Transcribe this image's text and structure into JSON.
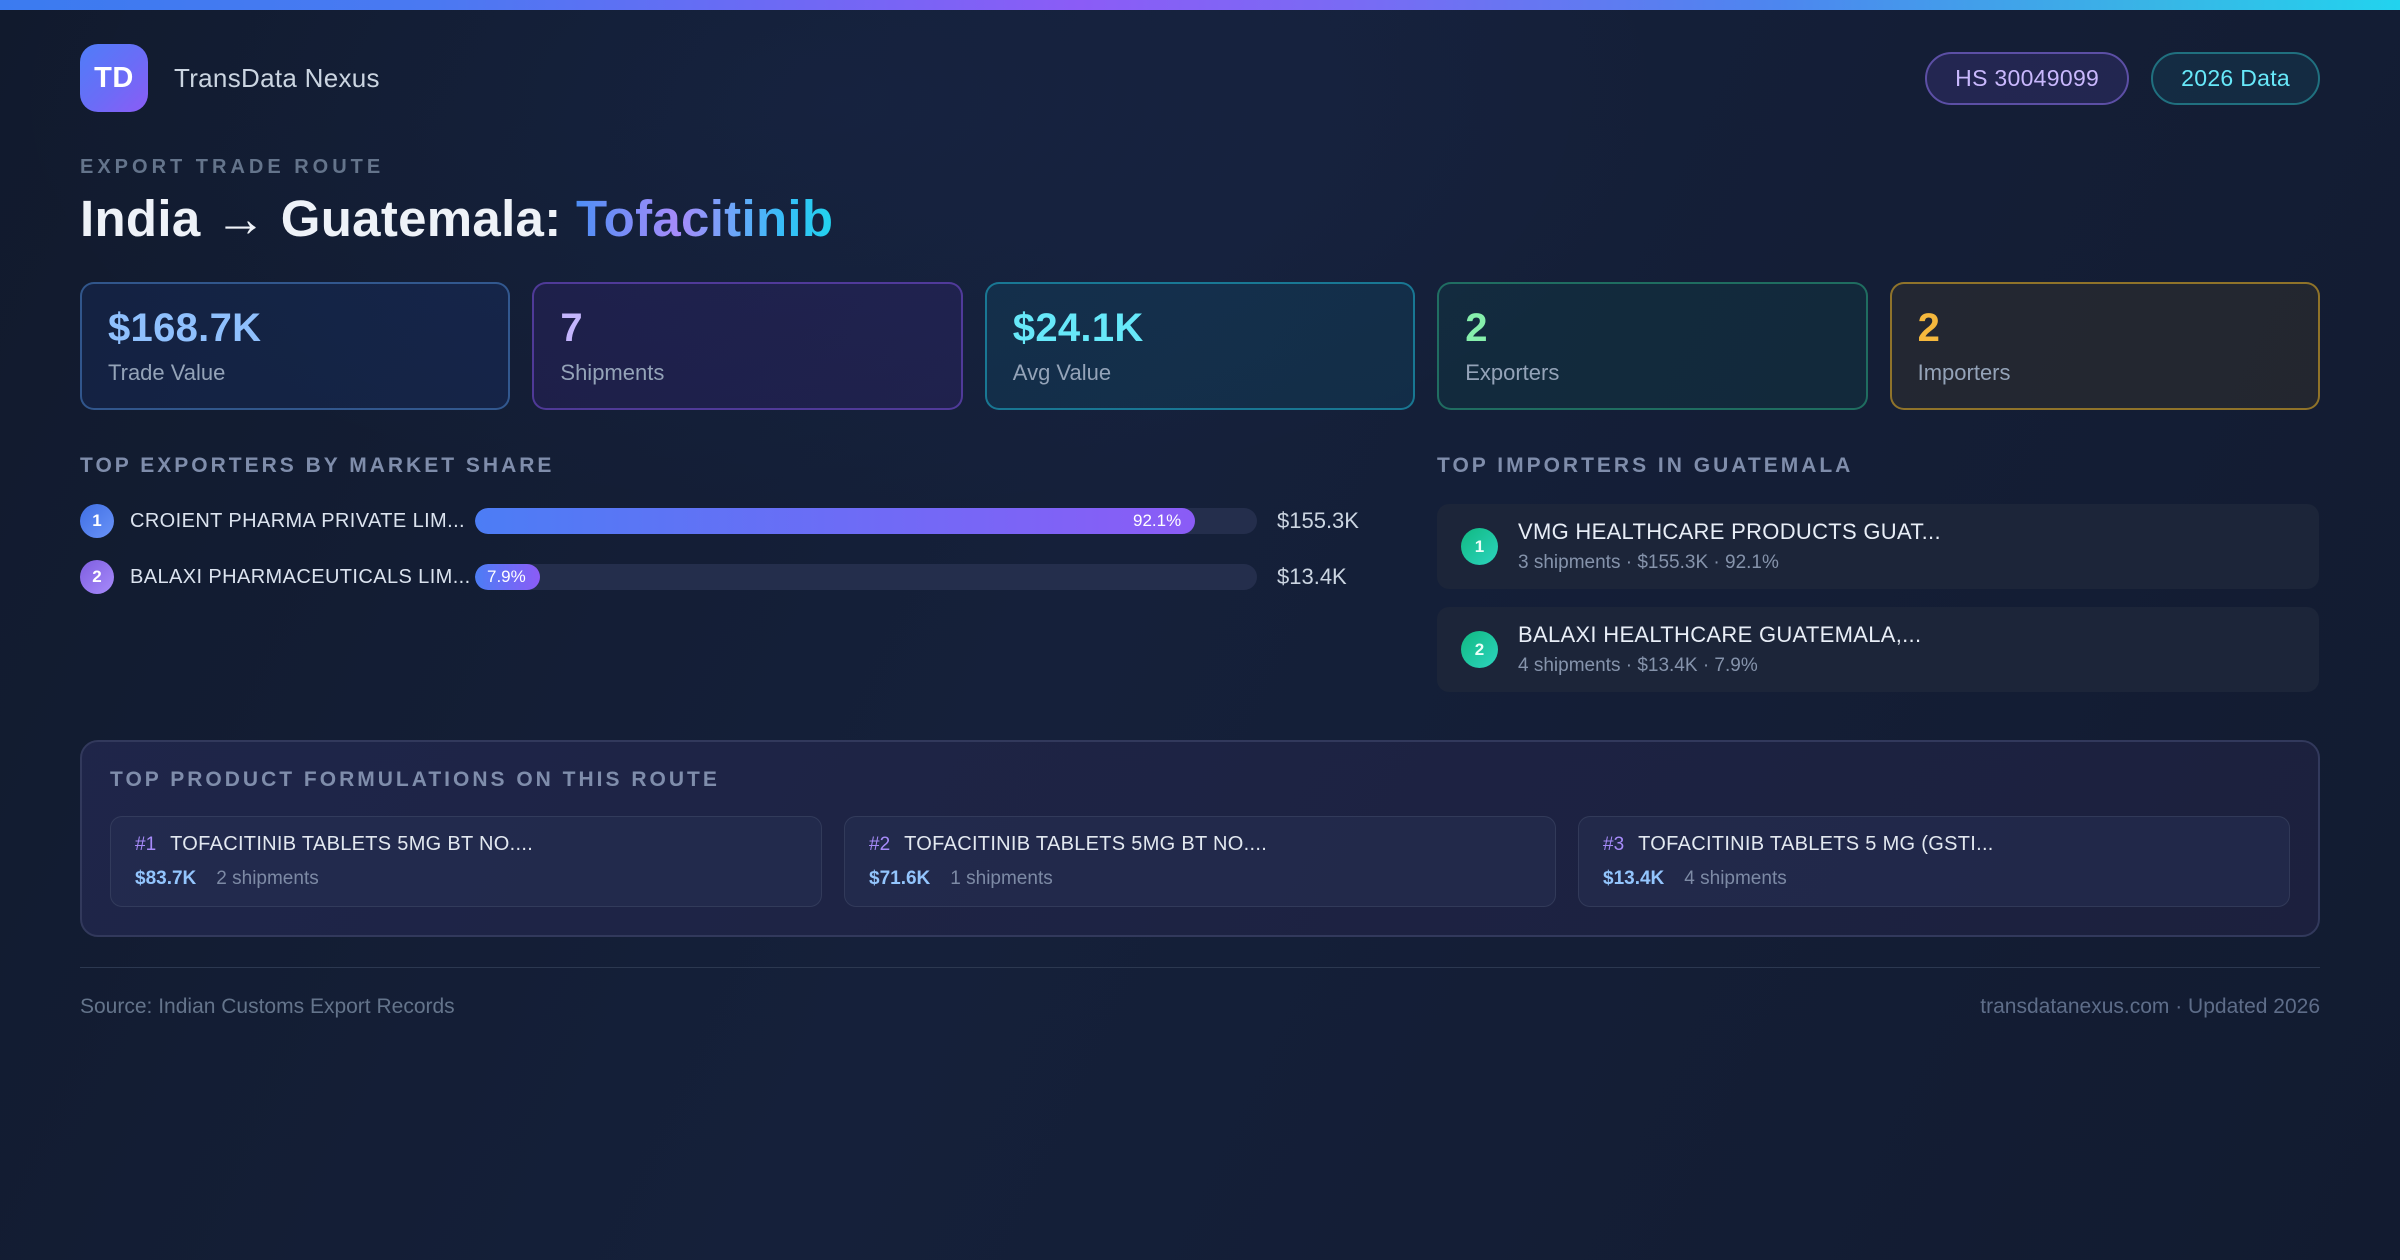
{
  "colors": {
    "accent_blue": "#3b82f6",
    "accent_purple": "#8b5cf6",
    "accent_cyan": "#22d3ee",
    "background": "#131c30"
  },
  "header": {
    "logo_text": "TD",
    "brand": "TransData Nexus",
    "hs_badge": "HS 30049099",
    "year_badge": "2026 Data"
  },
  "title": {
    "eyebrow": "EXPORT TRADE ROUTE",
    "route": "India → Guatemala: ",
    "product": "Tofacitinib"
  },
  "stats": [
    {
      "value": "$168.7K",
      "label": "Trade Value"
    },
    {
      "value": "7",
      "label": "Shipments"
    },
    {
      "value": "$24.1K",
      "label": "Avg Value"
    },
    {
      "value": "2",
      "label": "Exporters"
    },
    {
      "value": "2",
      "label": "Importers"
    }
  ],
  "exporters": {
    "section_title": "TOP EXPORTERS BY MARKET SHARE",
    "rows": [
      {
        "rank": "1",
        "name": "CROIENT PHARMA PRIVATE LIM...",
        "share_pct": 92.1,
        "share_label": "92.1%",
        "value": "$155.3K"
      },
      {
        "rank": "2",
        "name": "BALAXI PHARMACEUTICALS LIM...",
        "share_pct": 7.9,
        "share_label": "7.9%",
        "value": "$13.4K"
      }
    ]
  },
  "importers": {
    "section_title": "TOP IMPORTERS IN GUATEMALA",
    "rows": [
      {
        "rank": "1",
        "name": "VMG HEALTHCARE PRODUCTS GUAT...",
        "meta": "3 shipments · $155.3K · 92.1%"
      },
      {
        "rank": "2",
        "name": "BALAXI HEALTHCARE GUATEMALA,...",
        "meta": "4 shipments · $13.4K · 7.9%"
      }
    ]
  },
  "formulations": {
    "section_title": "TOP PRODUCT FORMULATIONS ON THIS ROUTE",
    "cards": [
      {
        "rank": "#1",
        "name": "TOFACITINIB TABLETS 5MG BT NO....",
        "value": "$83.7K",
        "shipments": "2 shipments"
      },
      {
        "rank": "#2",
        "name": "TOFACITINIB TABLETS 5MG BT NO....",
        "value": "$71.6K",
        "shipments": "1 shipments"
      },
      {
        "rank": "#3",
        "name": "TOFACITINIB TABLETS 5 MG (GSTI...",
        "value": "$13.4K",
        "shipments": "4 shipments"
      }
    ]
  },
  "footer": {
    "source": "Source: Indian Customs Export Records",
    "site": "transdatanexus.com · Updated 2026"
  }
}
